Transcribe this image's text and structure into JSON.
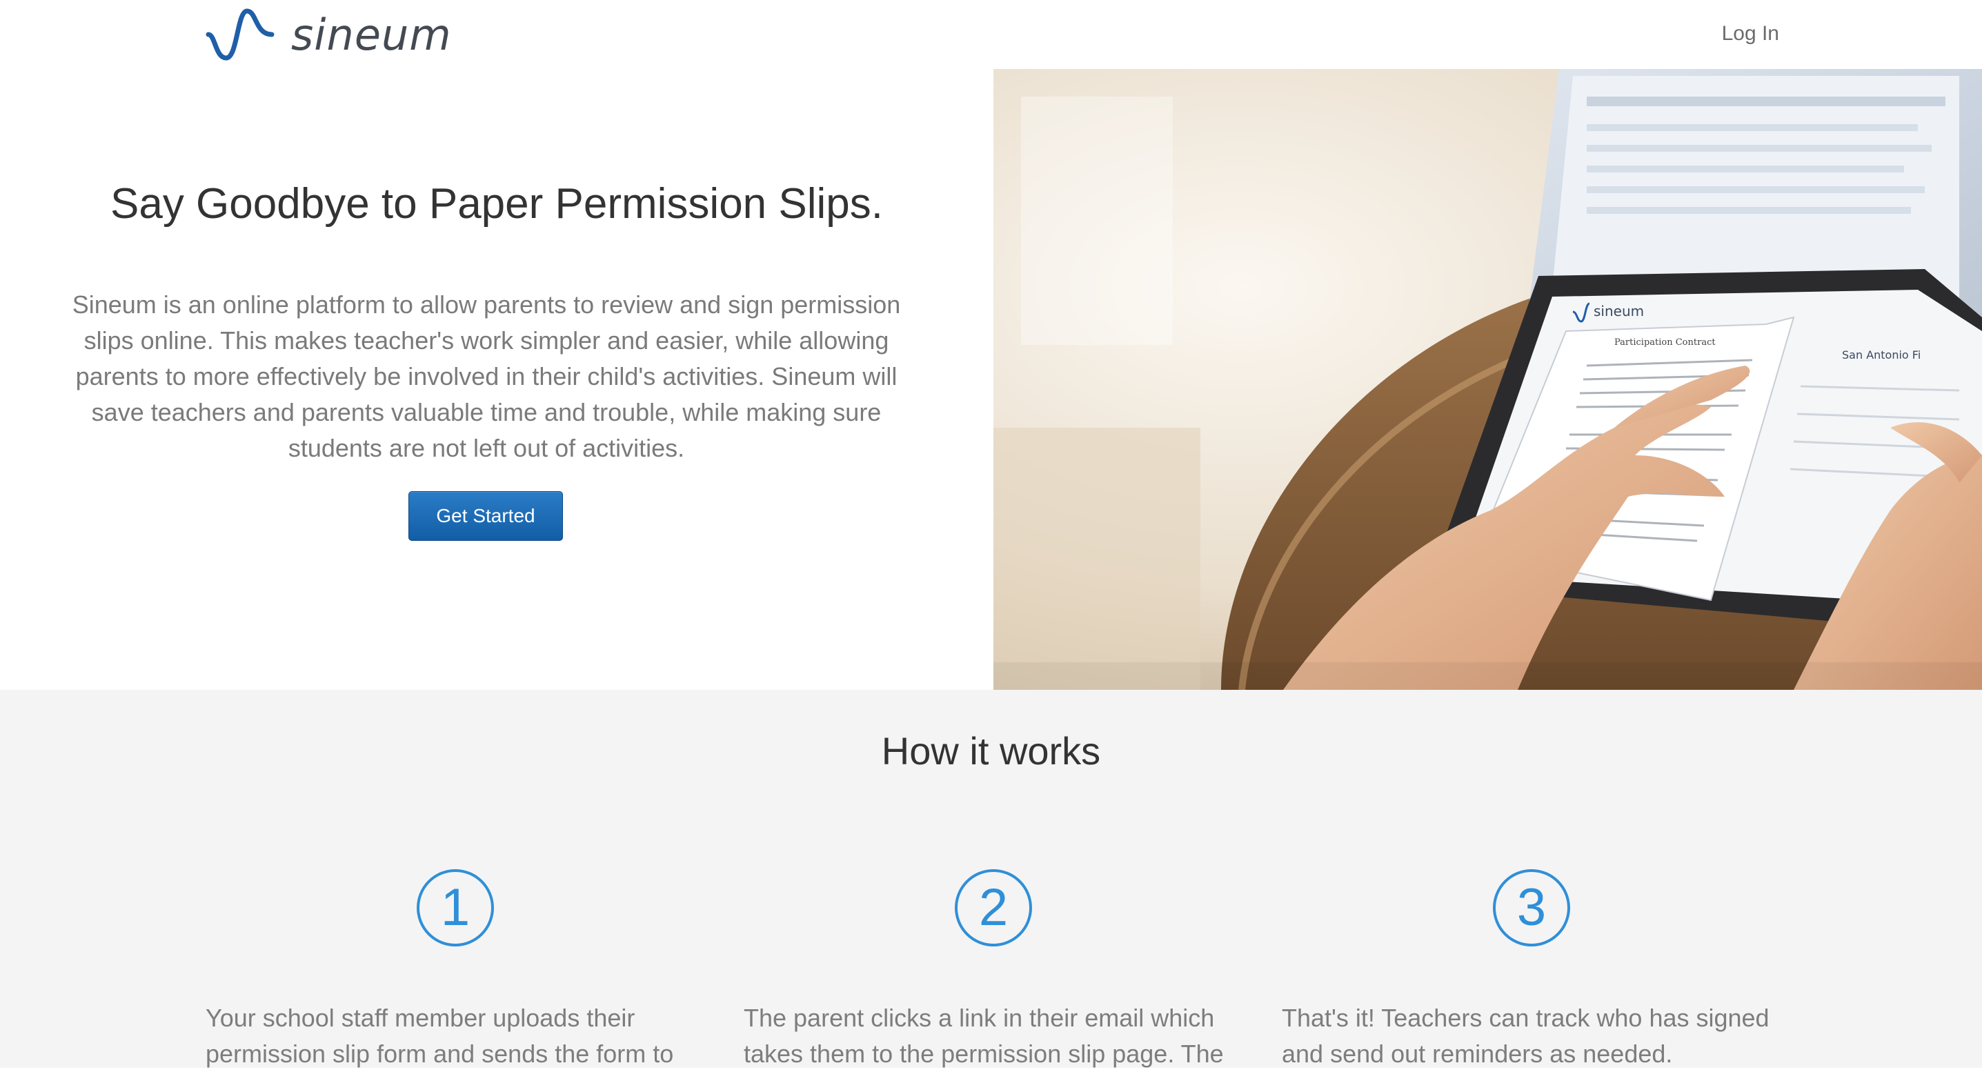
{
  "header": {
    "brand": "sineum",
    "login_label": "Log In"
  },
  "hero": {
    "title": "Say Goodbye to Paper Permission Slips.",
    "description": "Sineum is an online platform to allow parents to review and sign permission slips online. This makes teacher's work simpler and easier, while allowing parents to more effectively be involved in their child's activities. Sineum will save teachers and parents valuable time and trouble, while making sure students are not left out of activities.",
    "cta_label": "Get Started",
    "image": {
      "tablet_brand": "sineum",
      "doc_title": "San Antonio Fi",
      "doc_heading": "Participation Contract"
    }
  },
  "how": {
    "title": "How it works",
    "steps": [
      {
        "number": "1",
        "text": "Your school staff member uploads their permission slip form and sends the form to"
      },
      {
        "number": "2",
        "text": "The parent clicks a link in their email which takes them to the permission slip page. The"
      },
      {
        "number": "3",
        "text": "That's it! Teachers can track who has signed and send out reminders as needed."
      }
    ]
  },
  "colors": {
    "accent_blue": "#2f8fd8",
    "button_blue": "#1a6db8",
    "section_gray": "#f4f4f4"
  }
}
